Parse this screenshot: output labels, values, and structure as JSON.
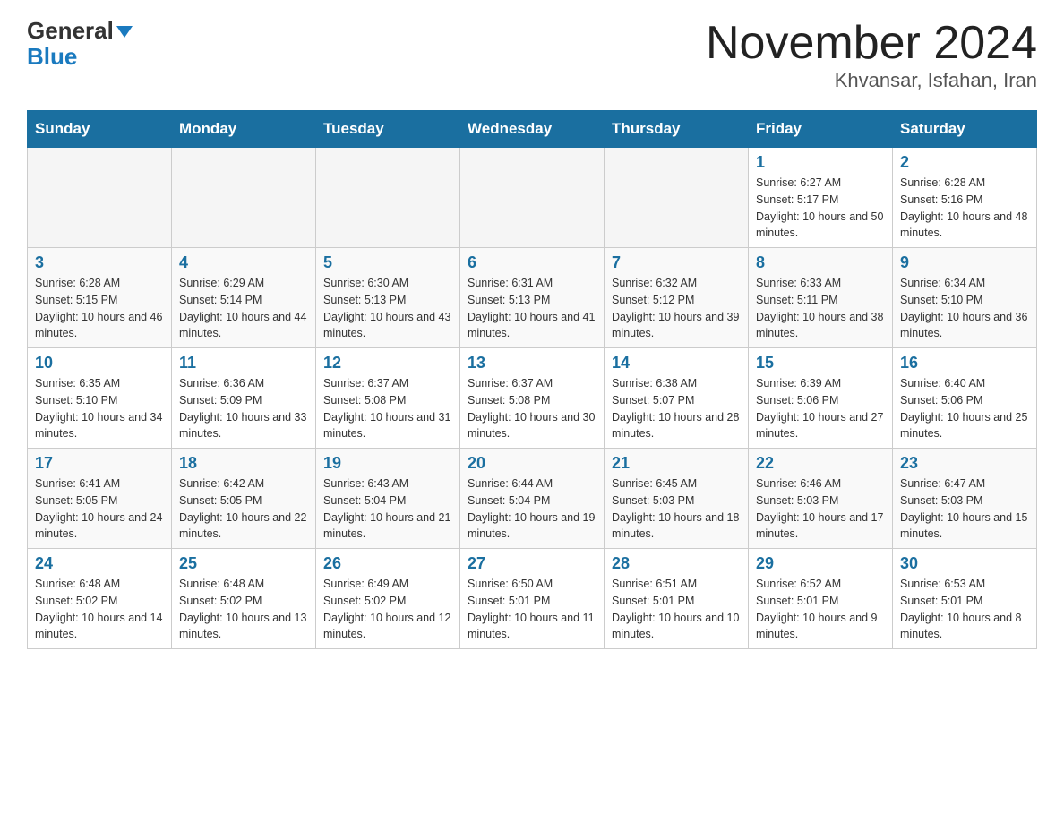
{
  "header": {
    "logo_line1": "General",
    "logo_line2": "Blue",
    "month_title": "November 2024",
    "subtitle": "Khvansar, Isfahan, Iran"
  },
  "calendar": {
    "days_of_week": [
      "Sunday",
      "Monday",
      "Tuesday",
      "Wednesday",
      "Thursday",
      "Friday",
      "Saturday"
    ],
    "weeks": [
      [
        {
          "day": "",
          "info": ""
        },
        {
          "day": "",
          "info": ""
        },
        {
          "day": "",
          "info": ""
        },
        {
          "day": "",
          "info": ""
        },
        {
          "day": "",
          "info": ""
        },
        {
          "day": "1",
          "info": "Sunrise: 6:27 AM\nSunset: 5:17 PM\nDaylight: 10 hours and 50 minutes."
        },
        {
          "day": "2",
          "info": "Sunrise: 6:28 AM\nSunset: 5:16 PM\nDaylight: 10 hours and 48 minutes."
        }
      ],
      [
        {
          "day": "3",
          "info": "Sunrise: 6:28 AM\nSunset: 5:15 PM\nDaylight: 10 hours and 46 minutes."
        },
        {
          "day": "4",
          "info": "Sunrise: 6:29 AM\nSunset: 5:14 PM\nDaylight: 10 hours and 44 minutes."
        },
        {
          "day": "5",
          "info": "Sunrise: 6:30 AM\nSunset: 5:13 PM\nDaylight: 10 hours and 43 minutes."
        },
        {
          "day": "6",
          "info": "Sunrise: 6:31 AM\nSunset: 5:13 PM\nDaylight: 10 hours and 41 minutes."
        },
        {
          "day": "7",
          "info": "Sunrise: 6:32 AM\nSunset: 5:12 PM\nDaylight: 10 hours and 39 minutes."
        },
        {
          "day": "8",
          "info": "Sunrise: 6:33 AM\nSunset: 5:11 PM\nDaylight: 10 hours and 38 minutes."
        },
        {
          "day": "9",
          "info": "Sunrise: 6:34 AM\nSunset: 5:10 PM\nDaylight: 10 hours and 36 minutes."
        }
      ],
      [
        {
          "day": "10",
          "info": "Sunrise: 6:35 AM\nSunset: 5:10 PM\nDaylight: 10 hours and 34 minutes."
        },
        {
          "day": "11",
          "info": "Sunrise: 6:36 AM\nSunset: 5:09 PM\nDaylight: 10 hours and 33 minutes."
        },
        {
          "day": "12",
          "info": "Sunrise: 6:37 AM\nSunset: 5:08 PM\nDaylight: 10 hours and 31 minutes."
        },
        {
          "day": "13",
          "info": "Sunrise: 6:37 AM\nSunset: 5:08 PM\nDaylight: 10 hours and 30 minutes."
        },
        {
          "day": "14",
          "info": "Sunrise: 6:38 AM\nSunset: 5:07 PM\nDaylight: 10 hours and 28 minutes."
        },
        {
          "day": "15",
          "info": "Sunrise: 6:39 AM\nSunset: 5:06 PM\nDaylight: 10 hours and 27 minutes."
        },
        {
          "day": "16",
          "info": "Sunrise: 6:40 AM\nSunset: 5:06 PM\nDaylight: 10 hours and 25 minutes."
        }
      ],
      [
        {
          "day": "17",
          "info": "Sunrise: 6:41 AM\nSunset: 5:05 PM\nDaylight: 10 hours and 24 minutes."
        },
        {
          "day": "18",
          "info": "Sunrise: 6:42 AM\nSunset: 5:05 PM\nDaylight: 10 hours and 22 minutes."
        },
        {
          "day": "19",
          "info": "Sunrise: 6:43 AM\nSunset: 5:04 PM\nDaylight: 10 hours and 21 minutes."
        },
        {
          "day": "20",
          "info": "Sunrise: 6:44 AM\nSunset: 5:04 PM\nDaylight: 10 hours and 19 minutes."
        },
        {
          "day": "21",
          "info": "Sunrise: 6:45 AM\nSunset: 5:03 PM\nDaylight: 10 hours and 18 minutes."
        },
        {
          "day": "22",
          "info": "Sunrise: 6:46 AM\nSunset: 5:03 PM\nDaylight: 10 hours and 17 minutes."
        },
        {
          "day": "23",
          "info": "Sunrise: 6:47 AM\nSunset: 5:03 PM\nDaylight: 10 hours and 15 minutes."
        }
      ],
      [
        {
          "day": "24",
          "info": "Sunrise: 6:48 AM\nSunset: 5:02 PM\nDaylight: 10 hours and 14 minutes."
        },
        {
          "day": "25",
          "info": "Sunrise: 6:48 AM\nSunset: 5:02 PM\nDaylight: 10 hours and 13 minutes."
        },
        {
          "day": "26",
          "info": "Sunrise: 6:49 AM\nSunset: 5:02 PM\nDaylight: 10 hours and 12 minutes."
        },
        {
          "day": "27",
          "info": "Sunrise: 6:50 AM\nSunset: 5:01 PM\nDaylight: 10 hours and 11 minutes."
        },
        {
          "day": "28",
          "info": "Sunrise: 6:51 AM\nSunset: 5:01 PM\nDaylight: 10 hours and 10 minutes."
        },
        {
          "day": "29",
          "info": "Sunrise: 6:52 AM\nSunset: 5:01 PM\nDaylight: 10 hours and 9 minutes."
        },
        {
          "day": "30",
          "info": "Sunrise: 6:53 AM\nSunset: 5:01 PM\nDaylight: 10 hours and 8 minutes."
        }
      ]
    ]
  }
}
